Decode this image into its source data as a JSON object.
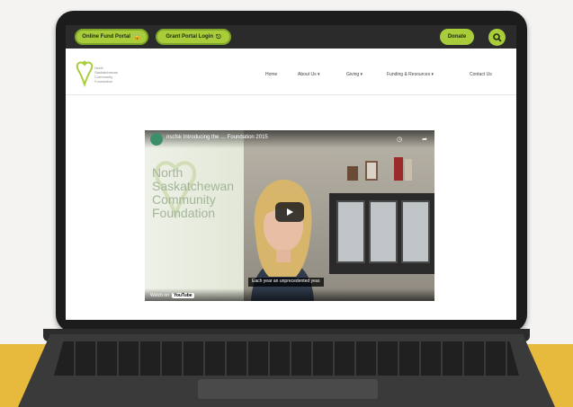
{
  "website": {
    "topbar": {
      "portal_1_label": "Online Fund Portal",
      "portal_2_label": "Grant Portal Login",
      "donate_label": "Donate"
    },
    "logo": {
      "lines": [
        "North",
        "Saskatchewan",
        "Community",
        "Foundation"
      ]
    },
    "nav": {
      "items": [
        "Home",
        "About Us ▾",
        "Giving ▾",
        "Funding & Resources ▾",
        "Contact Us"
      ]
    }
  },
  "video": {
    "channel_name": "nscfsk",
    "title": "Introducing the … Foundation 2015",
    "overlay_lines": [
      "North",
      "Saskatchewan",
      "Community",
      "Foundation"
    ],
    "caption": "Each year an unprecedented year.",
    "watch_on": "Watch on",
    "youtube_label": "YouTube",
    "icons": [
      "clock-icon",
      "share-icon",
      "play-icon"
    ]
  },
  "colors": {
    "brand_green": "#a9cd3a",
    "background_yellow": "#e7b93c",
    "bezel": "#1c1c1c"
  }
}
